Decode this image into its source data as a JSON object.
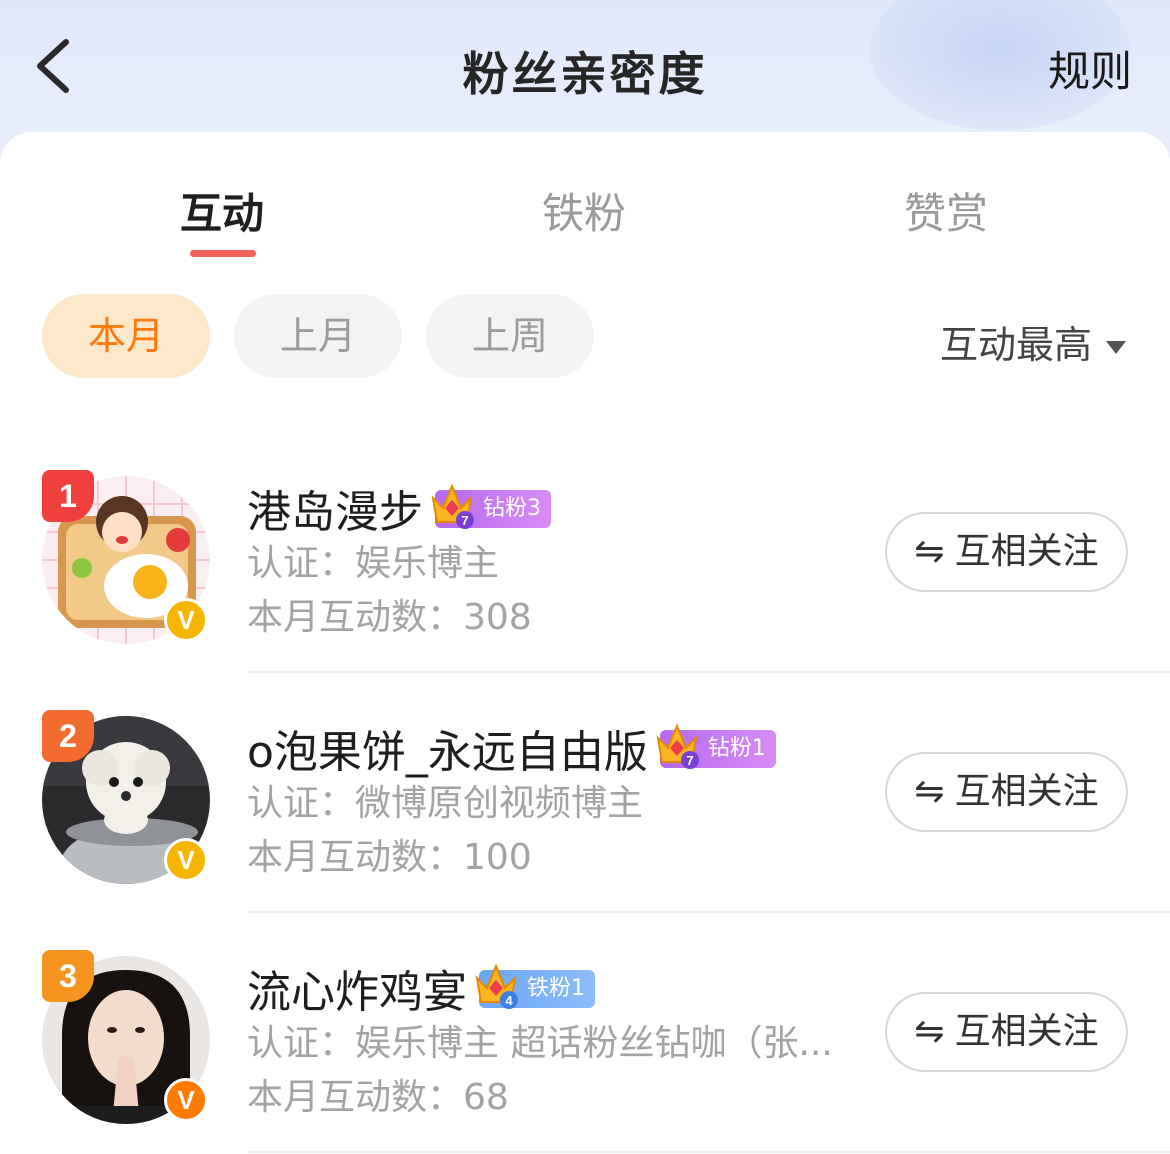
{
  "header": {
    "title": "粉丝亲密度",
    "rules_label": "规则",
    "back_icon": "chevron-left-icon"
  },
  "tabs": [
    {
      "label": "互动",
      "active": true
    },
    {
      "label": "铁粉",
      "active": false
    },
    {
      "label": "赞赏",
      "active": false
    }
  ],
  "filters": [
    {
      "label": "本月",
      "active": true
    },
    {
      "label": "上月",
      "active": false
    },
    {
      "label": "上周",
      "active": false
    }
  ],
  "sort": {
    "label": "互动最高",
    "icon": "caret-down-icon"
  },
  "fans": [
    {
      "rank": "1",
      "name": "港岛漫步",
      "badge": "钻粉3",
      "badge_level": "7",
      "cert": "认证：娱乐博主",
      "count": "本月互动数：308",
      "follow_label": "互相关注",
      "follow_icon": "⇋"
    },
    {
      "rank": "2",
      "name": "o泡果饼_永远自由版",
      "badge": "钻粉1",
      "badge_level": "7",
      "cert": "认证：微博原创视频博主",
      "count": "本月互动数：100",
      "follow_label": "互相关注",
      "follow_icon": "⇋"
    },
    {
      "rank": "3",
      "name": "流心炸鸡宴",
      "badge": "铁粉1",
      "badge_level": "4",
      "cert": "认证：娱乐博主 超话粉丝钻咖（张...",
      "count": "本月互动数：68",
      "follow_label": "互相关注",
      "follow_icon": "⇋"
    }
  ],
  "colors": {
    "accent": "#f2625b",
    "filter_active_bg": "#fde8c9",
    "filter_active_text": "#ff7b10",
    "verified_gold": "#f7b500",
    "verified_orange": "#ff7a00"
  }
}
